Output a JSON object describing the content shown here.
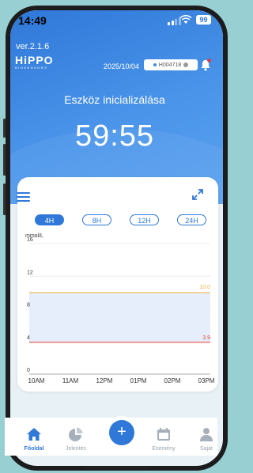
{
  "status": {
    "time": "14:49",
    "battery": "99"
  },
  "app": {
    "version": "ver.2.1.6",
    "logo_main": "HiPPO",
    "logo_sub": "BIOSENSORS"
  },
  "header": {
    "date": "2025/10/04",
    "device_id": "H004718",
    "title": "Eszköz inicializálása",
    "countdown": "59:55"
  },
  "chart_controls": {
    "ranges": [
      "4H",
      "8H",
      "12H",
      "24H"
    ],
    "active_range": "4H"
  },
  "chart_data": {
    "type": "line",
    "ylabel": "mmol/L",
    "ylim": [
      0,
      16
    ],
    "y_ticks": [
      "0",
      "4",
      "8",
      "12",
      "16"
    ],
    "x_ticks": [
      "10AM",
      "11AM",
      "12PM",
      "01PM",
      "02PM",
      "03PM"
    ],
    "target_range": {
      "low": 3.9,
      "high": 10.0,
      "low_label": "3.9",
      "high_label": "10.0"
    },
    "series": [],
    "grid": true,
    "colors": {
      "high_line": "#f2b33d",
      "low_line": "#e0443a",
      "band": "#e6eefb"
    }
  },
  "tabs": [
    {
      "label": "Főoldal",
      "icon": "home-icon",
      "active": true
    },
    {
      "label": "Jelentés",
      "icon": "pie-chart-icon",
      "active": false
    },
    {
      "label": "Esemény",
      "icon": "calendar-icon",
      "active": false
    },
    {
      "label": "Saját",
      "icon": "person-icon",
      "active": false
    }
  ],
  "fab": {
    "label": "+"
  },
  "theme": {
    "accent": "#2f78d8"
  }
}
